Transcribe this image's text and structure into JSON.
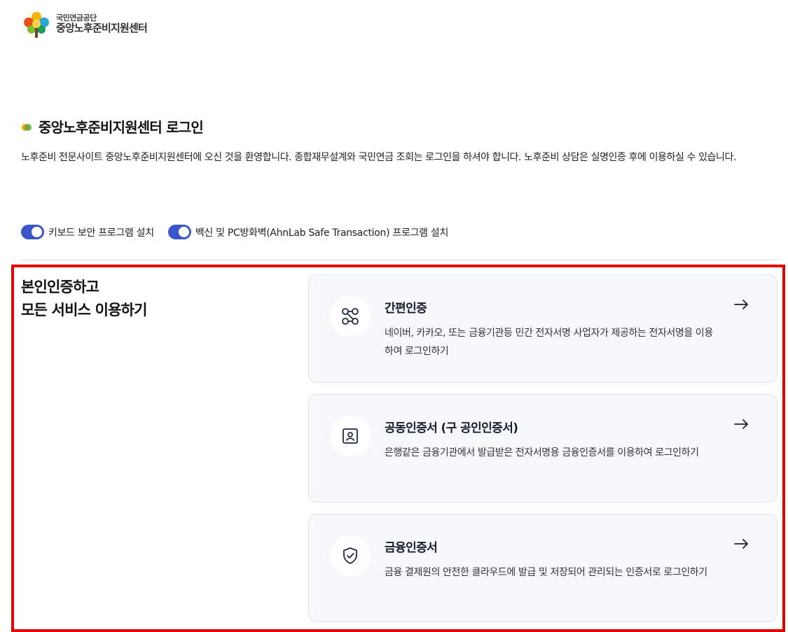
{
  "header": {
    "logo_sub": "국민연금공단",
    "logo_main": "중앙노후준비지원센터"
  },
  "page": {
    "title": "중앙노후준비지원센터 로그인",
    "intro": "노후준비 전문사이트 중앙노후준비지원센터에 오신 것을 환영합니다. 종합재무설계와 국민연금 조회는 로그인을 하셔야 합니다. 노후준비 상담은 실명인증 후에 이용하실 수 있습니다."
  },
  "toggles": [
    {
      "label": "키보드 보안 프로그램 설치",
      "on": true
    },
    {
      "label": "백신 및 PC방화벽(AhnLab Safe Transaction) 프로그램 설치",
      "on": true
    }
  ],
  "auth": {
    "heading_line1": "본인인증하고",
    "heading_line2": "모든 서비스 이용하기",
    "options": [
      {
        "title": "간편인증",
        "desc": "네이버, 카카오, 또는 금융기관등 민간 전자서명 사업자가 제공하는 전자서명을 이용하여 로그인하기",
        "icon": "connection-icon"
      },
      {
        "title": "공동인증서 (구 공인인증서)",
        "desc": "은행같은 금융기관에서 발급받은 전자서명용 금융인증서를 이용하여 로그인하기",
        "icon": "id-card-icon"
      },
      {
        "title": "금융인증서",
        "desc": "금융 결제원의 안전한 클라우드에 발급 및 저장되어 관리되는 인증서로 로그인하기",
        "icon": "shield-check-icon"
      }
    ]
  },
  "colors": {
    "accent": "#3a56c9",
    "highlight": "#e60000",
    "card_bg": "#f6f8fb",
    "icon_stroke": "#1f2a44"
  }
}
